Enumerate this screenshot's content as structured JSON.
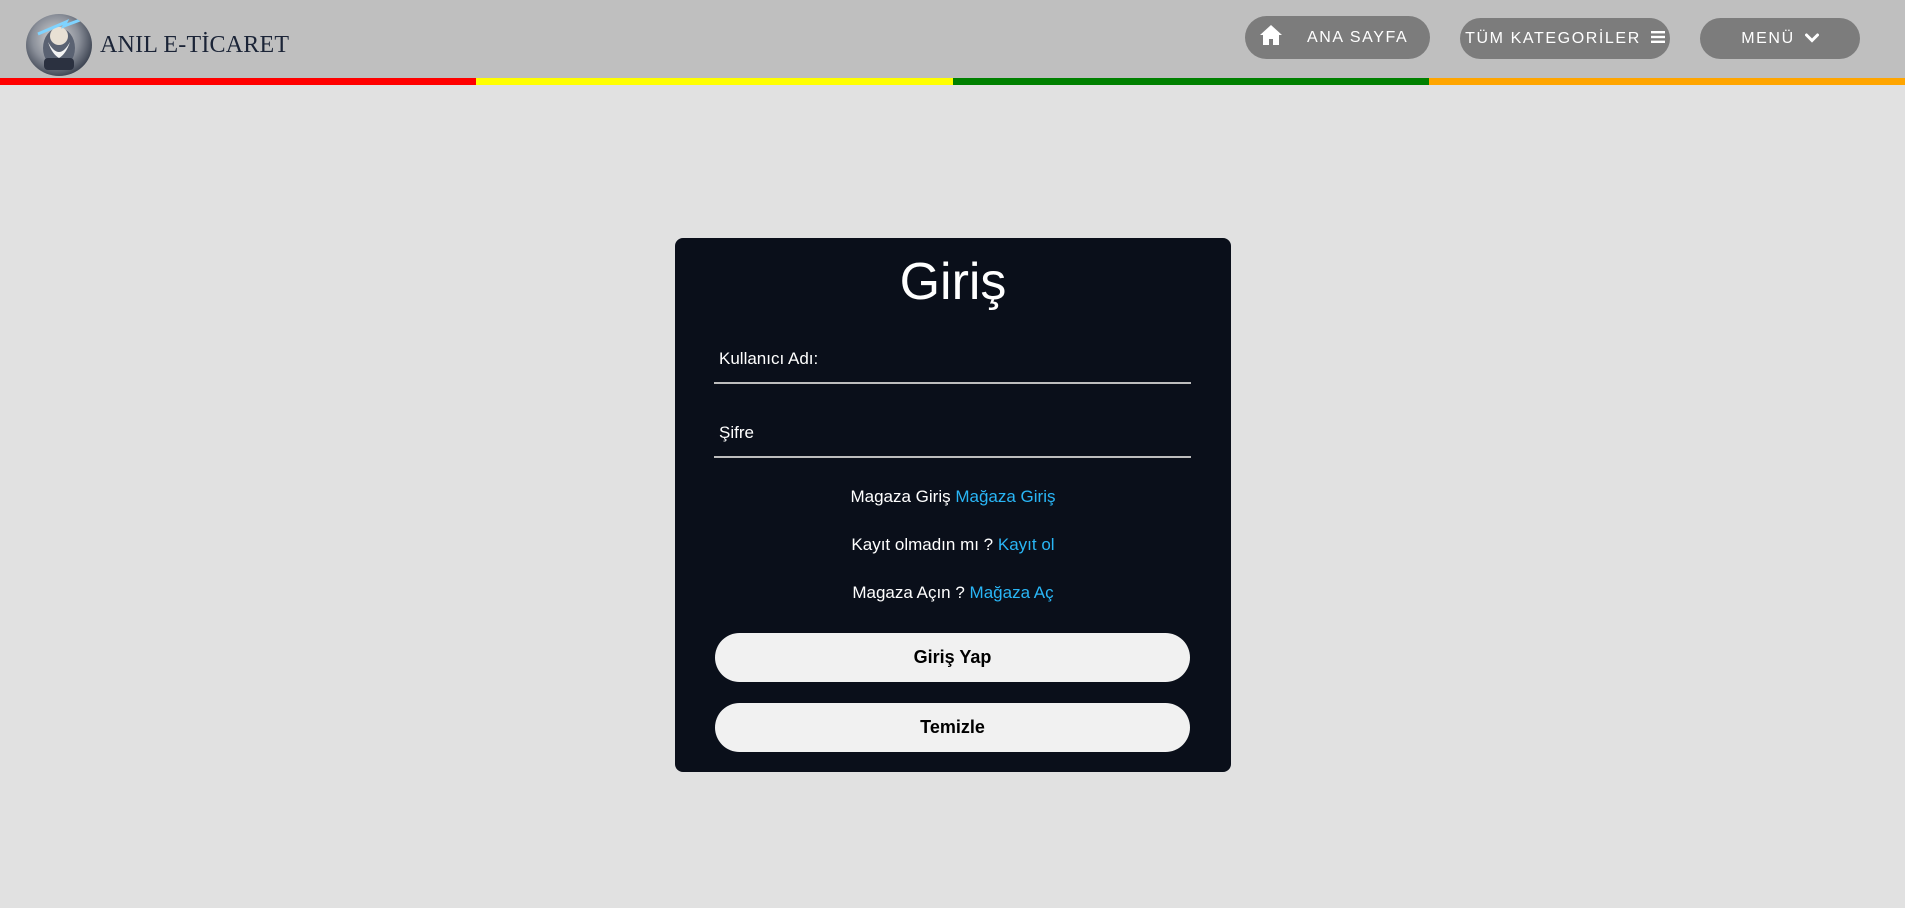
{
  "brand": {
    "name": "ANIL E-TİCARET",
    "logo_icon": "wizard-logo-icon"
  },
  "nav": {
    "home_label": "ANA SAYFA",
    "home_icon": "home-icon",
    "categories_label": "TÜM KATEGORİLER",
    "categories_icon": "hamburger-icon",
    "menu_label": "MENÜ",
    "menu_icon": "chevron-down-icon"
  },
  "stripes": [
    "#ff0000",
    "#ffff00",
    "#008000",
    "#ffa500"
  ],
  "login": {
    "title": "Giriş",
    "username_placeholder": "Kullanıcı Adı:",
    "username_value": "",
    "password_placeholder": "Şifre",
    "password_value": "",
    "store_login_text": "Magaza Giriş",
    "store_login_link": "Mağaza Giriş",
    "register_text": "Kayıt olmadın mı ?",
    "register_link": "Kayıt ol",
    "open_store_text": "Magaza Açın ?",
    "open_store_link": "Mağaza Aç",
    "submit_label": "Giriş Yap",
    "clear_label": "Temizle"
  },
  "colors": {
    "nav_bg": "#bfbfbf",
    "page_bg": "#e1e1e1",
    "card_bg": "#0a0f1a",
    "link": "#29b6f6",
    "nav_button": "#7c7c7c"
  }
}
